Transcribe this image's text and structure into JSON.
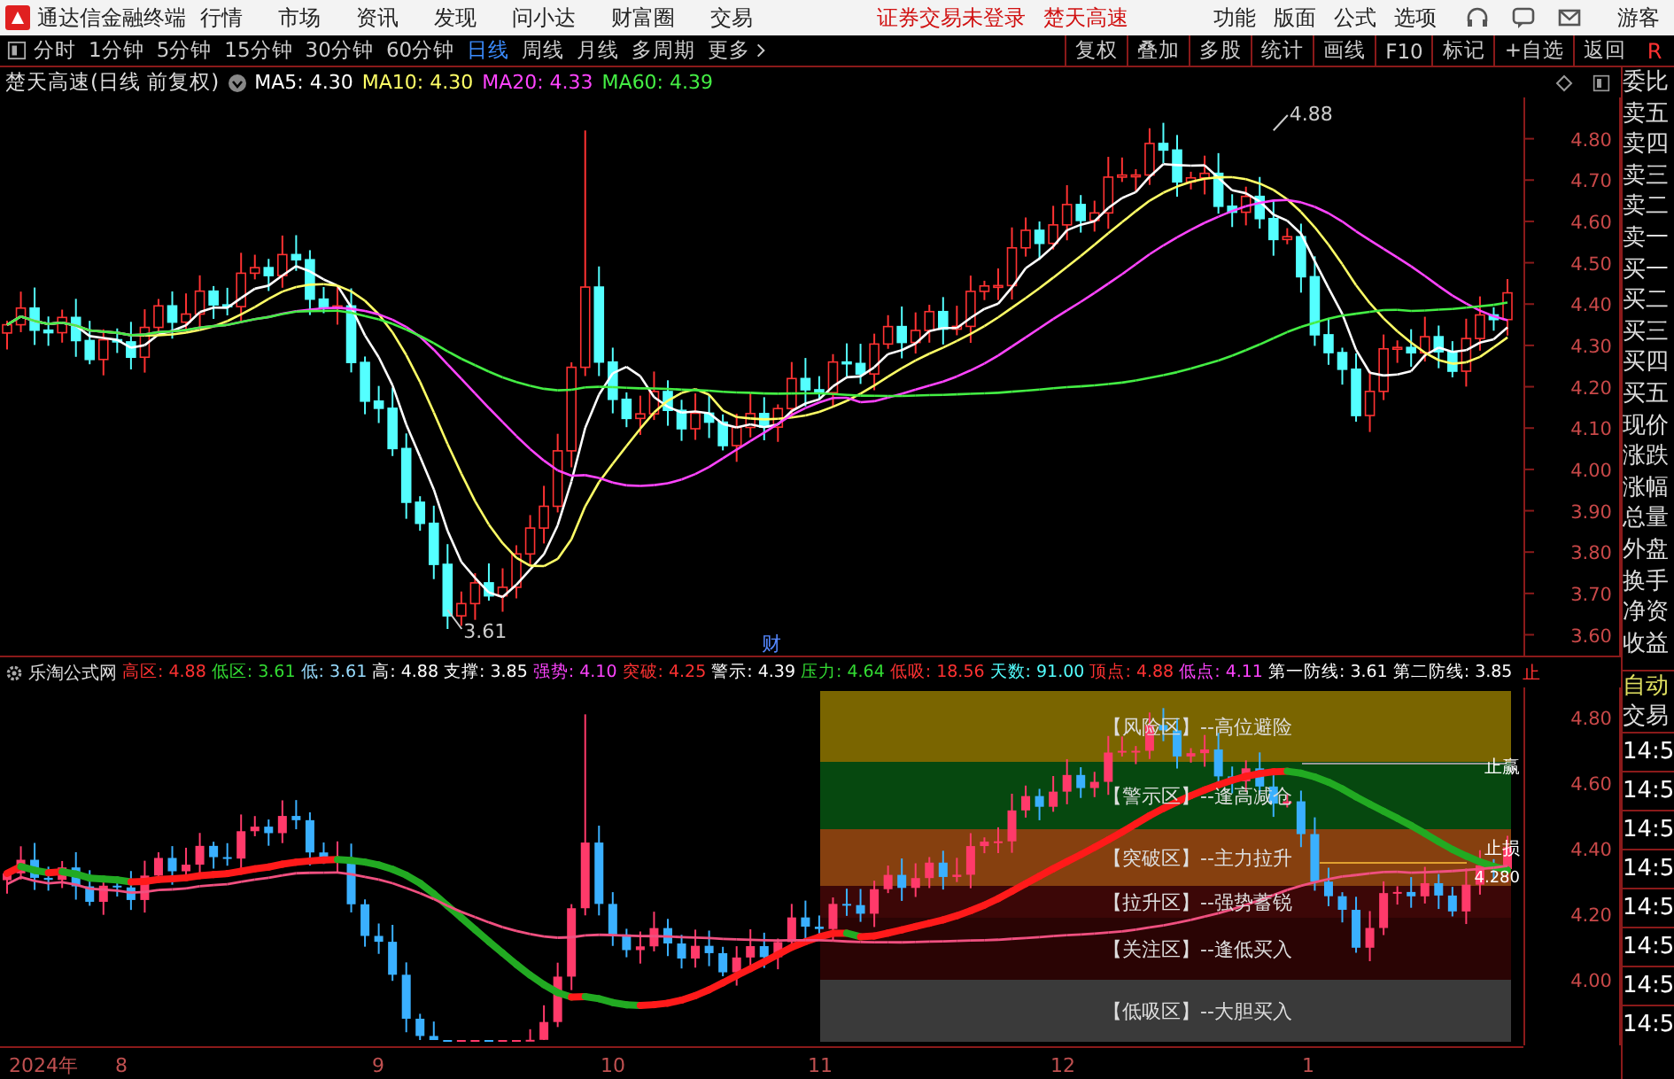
{
  "menu_bar": {
    "app_title": "通达信金融终端",
    "menus": [
      "行情",
      "市场",
      "资讯",
      "发现",
      "问小达",
      "财富圈",
      "交易"
    ],
    "notices": [
      "证券交易未登录",
      "楚天高速"
    ],
    "right_menus": [
      "功能",
      "版面",
      "公式",
      "选项"
    ],
    "user": "游客"
  },
  "period_bar": {
    "periods": [
      {
        "label": "分时",
        "selected": false
      },
      {
        "label": "1分钟",
        "selected": false
      },
      {
        "label": "5分钟",
        "selected": false
      },
      {
        "label": "15分钟",
        "selected": false
      },
      {
        "label": "30分钟",
        "selected": false
      },
      {
        "label": "60分钟",
        "selected": false
      },
      {
        "label": "日线",
        "selected": true
      },
      {
        "label": "周线",
        "selected": false
      },
      {
        "label": "月线",
        "selected": false
      },
      {
        "label": "多周期",
        "selected": false
      }
    ],
    "more": "更多",
    "actions": [
      "复权",
      "叠加",
      "多股",
      "统计",
      "画线",
      "F10",
      "标记",
      "+自选",
      "返回"
    ],
    "edge": "R"
  },
  "main_chart": {
    "title": "楚天高速(日线 前复权)",
    "moving_averages": [
      {
        "label": "MA5: 4.30",
        "color": "#ffffff"
      },
      {
        "label": "MA10: 4.30",
        "color": "#ffff66"
      },
      {
        "label": "MA20: 4.33",
        "color": "#ff44ff"
      },
      {
        "label": "MA60: 4.39",
        "color": "#44ee44"
      }
    ],
    "y_axis": [
      "4.80",
      "4.70",
      "4.60",
      "4.50",
      "4.40",
      "4.30",
      "4.20",
      "4.10",
      "4.00",
      "3.90",
      "3.80",
      "3.70",
      "3.60"
    ],
    "high_mark": "4.88",
    "low_mark": "3.61",
    "event_mark": "财"
  },
  "indicator": {
    "name": "乐淘公式网",
    "readings": [
      {
        "text": "高区: 4.88",
        "color": "#ff3232"
      },
      {
        "text": "低区: 3.61",
        "color": "#33dd33"
      },
      {
        "text": "低: 3.61",
        "color": "#99ddff"
      },
      {
        "text": "高: 4.88",
        "color": "#ffffff"
      },
      {
        "text": "支撑: 3.85",
        "color": "#ffffff"
      },
      {
        "text": "强势: 4.10",
        "color": "#ff44ff"
      },
      {
        "text": "突破: 4.25",
        "color": "#ff3232"
      },
      {
        "text": "警示: 4.39",
        "color": "#ffffff"
      },
      {
        "text": "压力: 4.64",
        "color": "#33dd33"
      },
      {
        "text": "低吸: 18.56",
        "color": "#ff3232"
      },
      {
        "text": "天数: 91.00",
        "color": "#54ffff"
      },
      {
        "text": "顶点: 4.88",
        "color": "#ff3232"
      },
      {
        "text": "低点: 4.11",
        "color": "#ff44ff"
      },
      {
        "text": "第一防线: 3.61",
        "color": "#ffffff"
      },
      {
        "text": "第二防线: 3.85",
        "color": "#ffffff"
      }
    ],
    "edge_label": "止",
    "zones": [
      {
        "label": "【风险区】--高位避险",
        "color": "#7a6500"
      },
      {
        "label": "【警示区】--逢高减仓",
        "color": "#06480f"
      },
      {
        "label": "【突破区】--主力拉升",
        "color": "#86400f"
      },
      {
        "label": "【拉升区】--强势蓄锐",
        "color": "#3c0707"
      },
      {
        "label": "【关注区】--逢低买入",
        "color": "#2a0404"
      },
      {
        "label": "【低吸区】--大胆买入",
        "color": "#3a3a3a"
      }
    ],
    "y_axis": [
      "4.80",
      "4.60",
      "4.40",
      "4.20",
      "4.00"
    ],
    "stop_profit": "止赢",
    "stop_loss": "止损",
    "stop_loss_price": "4.280"
  },
  "time_axis": [
    "2024年",
    "8",
    "9",
    "10",
    "11",
    "12",
    "1"
  ],
  "quote_panel": {
    "fields": [
      "委比",
      "卖五",
      "卖四",
      "卖三",
      "卖二",
      "卖一",
      "买一",
      "买二",
      "买三",
      "买四",
      "买五",
      "现价",
      "涨跌",
      "涨幅",
      "总量",
      "外盘",
      "换手",
      "净资",
      "收益"
    ],
    "trade_tabs": [
      "自动",
      "交易"
    ],
    "trade_times": [
      "14:5",
      "14:5",
      "14:5",
      "14:5",
      "14:5",
      "14:5",
      "14:5",
      "14:5"
    ]
  }
}
